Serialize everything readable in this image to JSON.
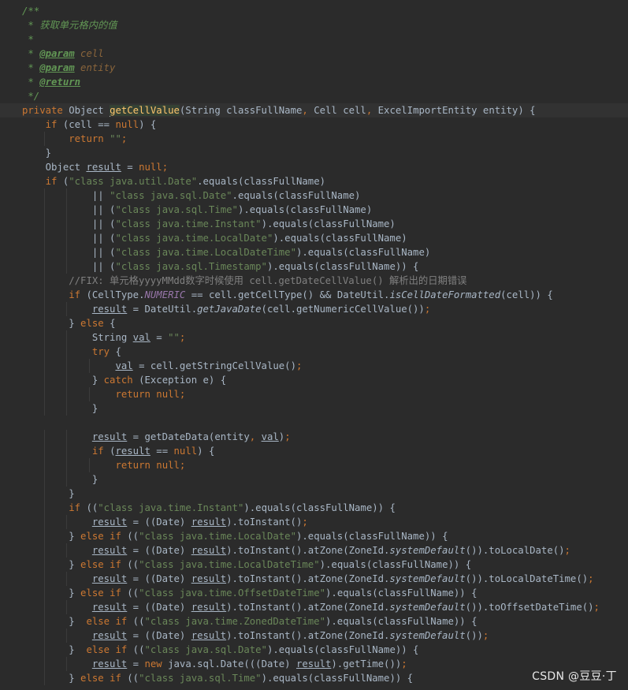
{
  "editor": {
    "theme_colors": {
      "background": "#2b2b2b",
      "default_text": "#a9b7c6",
      "keyword": "#cc7832",
      "string": "#6a8759",
      "doc_comment": "#629755",
      "line_comment": "#808080",
      "method_declaration": "#ffc66d",
      "static_field": "#9876aa"
    },
    "lines": [
      {
        "tokens": [
          {
            "t": "/**",
            "c": "cmt"
          }
        ]
      },
      {
        "tokens": [
          {
            "t": " * 获取单元格内的值",
            "c": "cmt"
          }
        ]
      },
      {
        "tokens": [
          {
            "t": " *",
            "c": "cmt"
          }
        ]
      },
      {
        "tokens": [
          {
            "t": " * ",
            "c": "cmt"
          },
          {
            "t": "@param",
            "c": "tag"
          },
          {
            "t": " cell",
            "c": "tagval"
          }
        ]
      },
      {
        "tokens": [
          {
            "t": " * ",
            "c": "cmt"
          },
          {
            "t": "@param",
            "c": "tag"
          },
          {
            "t": " entity",
            "c": "tagval"
          }
        ]
      },
      {
        "tokens": [
          {
            "t": " * ",
            "c": "cmt"
          },
          {
            "t": "@return",
            "c": "tag"
          }
        ]
      },
      {
        "tokens": [
          {
            "t": " */",
            "c": "cmt"
          }
        ]
      },
      {
        "caret": true,
        "tokens": [
          {
            "t": "private ",
            "c": "kw"
          },
          {
            "t": "Object "
          },
          {
            "caret": true
          },
          {
            "t": "getCellValue",
            "c": "fn-decl hl"
          },
          {
            "t": "(String classFullName"
          },
          {
            "t": ", ",
            "c": "kw"
          },
          {
            "t": "Cell cell"
          },
          {
            "t": ", ",
            "c": "kw"
          },
          {
            "t": "ExcelImportEntity entity) {"
          }
        ]
      },
      {
        "tokens": [
          {
            "t": "    "
          },
          {
            "t": "if ",
            "c": "kw"
          },
          {
            "t": "(cell == "
          },
          {
            "t": "null",
            "c": "kw"
          },
          {
            "t": ") {"
          }
        ]
      },
      {
        "tokens": [
          {
            "t": "        "
          },
          {
            "t": "return ",
            "c": "kw"
          },
          {
            "t": "\"\"",
            "c": "str"
          },
          {
            "t": ";",
            "c": "kw"
          }
        ]
      },
      {
        "tokens": [
          {
            "t": "    }"
          }
        ]
      },
      {
        "tokens": [
          {
            "t": "    Object "
          },
          {
            "t": "result",
            "c": "ul"
          },
          {
            "t": " = "
          },
          {
            "t": "null",
            "c": "kw"
          },
          {
            "t": ";",
            "c": "kw"
          }
        ]
      },
      {
        "tokens": [
          {
            "t": "    "
          },
          {
            "t": "if ",
            "c": "kw"
          },
          {
            "t": "("
          },
          {
            "t": "\"class java.util.Date\"",
            "c": "str"
          },
          {
            "t": ".equals(classFullName)"
          }
        ]
      },
      {
        "tokens": [
          {
            "t": "            || "
          },
          {
            "t": "\"class java.sql.Date\"",
            "c": "str"
          },
          {
            "t": ".equals(classFullName)"
          }
        ]
      },
      {
        "tokens": [
          {
            "t": "            || ("
          },
          {
            "t": "\"class java.sql.Time\"",
            "c": "str"
          },
          {
            "t": ").equals(classFullName)"
          }
        ]
      },
      {
        "tokens": [
          {
            "t": "            || ("
          },
          {
            "t": "\"class java.time.Instant\"",
            "c": "str"
          },
          {
            "t": ").equals(classFullName)"
          }
        ]
      },
      {
        "tokens": [
          {
            "t": "            || ("
          },
          {
            "t": "\"class java.time.LocalDate\"",
            "c": "str"
          },
          {
            "t": ").equals(classFullName)"
          }
        ]
      },
      {
        "tokens": [
          {
            "t": "            || ("
          },
          {
            "t": "\"class java.time.LocalDateTime\"",
            "c": "str"
          },
          {
            "t": ").equals(classFullName)"
          }
        ]
      },
      {
        "tokens": [
          {
            "t": "            || ("
          },
          {
            "t": "\"class java.sql.Timestamp\"",
            "c": "str"
          },
          {
            "t": ").equals(classFullName)) {"
          }
        ]
      },
      {
        "tokens": [
          {
            "t": "        "
          },
          {
            "t": "//FIX: 单元格yyyyMMdd数字时候使用 cell.getDateCellValue() 解析出的日期错误",
            "c": "line-cmt"
          }
        ]
      },
      {
        "tokens": [
          {
            "t": "        "
          },
          {
            "t": "if ",
            "c": "kw"
          },
          {
            "t": "(CellType."
          },
          {
            "t": "NUMERIC",
            "c": "static-field"
          },
          {
            "t": " == cell.getCellType() && DateUtil."
          },
          {
            "t": "isCellDateFormatted",
            "c": "static-call"
          },
          {
            "t": "(cell)) {"
          }
        ]
      },
      {
        "tokens": [
          {
            "t": "            "
          },
          {
            "t": "result",
            "c": "ul"
          },
          {
            "t": " = DateUtil."
          },
          {
            "t": "getJavaDate",
            "c": "static-call"
          },
          {
            "t": "(cell.getNumericCellValue())"
          },
          {
            "t": ";",
            "c": "kw"
          }
        ]
      },
      {
        "tokens": [
          {
            "t": "        } "
          },
          {
            "t": "else ",
            "c": "kw"
          },
          {
            "t": "{"
          }
        ]
      },
      {
        "tokens": [
          {
            "t": "            String "
          },
          {
            "t": "val",
            "c": "ul"
          },
          {
            "t": " = "
          },
          {
            "t": "\"\"",
            "c": "str"
          },
          {
            "t": ";",
            "c": "kw"
          }
        ]
      },
      {
        "tokens": [
          {
            "t": "            "
          },
          {
            "t": "try ",
            "c": "kw"
          },
          {
            "t": "{"
          }
        ]
      },
      {
        "tokens": [
          {
            "t": "                "
          },
          {
            "t": "val",
            "c": "ul"
          },
          {
            "t": " = cell.getStringCellValue()"
          },
          {
            "t": ";",
            "c": "kw"
          }
        ]
      },
      {
        "tokens": [
          {
            "t": "            } "
          },
          {
            "t": "catch ",
            "c": "kw"
          },
          {
            "t": "(Exception e) {"
          }
        ]
      },
      {
        "tokens": [
          {
            "t": "                "
          },
          {
            "t": "return null;",
            "c": "kw"
          }
        ]
      },
      {
        "tokens": [
          {
            "t": "            }"
          }
        ]
      },
      {
        "tokens": [
          {
            "t": ""
          }
        ]
      },
      {
        "tokens": [
          {
            "t": "            "
          },
          {
            "t": "result",
            "c": "ul"
          },
          {
            "t": " = getDateData(entity"
          },
          {
            "t": ", ",
            "c": "kw"
          },
          {
            "t": "val",
            "c": "ul"
          },
          {
            "t": ")"
          },
          {
            "t": ";",
            "c": "kw"
          }
        ]
      },
      {
        "tokens": [
          {
            "t": "            "
          },
          {
            "t": "if ",
            "c": "kw"
          },
          {
            "t": "("
          },
          {
            "t": "result",
            "c": "ul"
          },
          {
            "t": " == "
          },
          {
            "t": "null",
            "c": "kw"
          },
          {
            "t": ") {"
          }
        ]
      },
      {
        "tokens": [
          {
            "t": "                "
          },
          {
            "t": "return null;",
            "c": "kw"
          }
        ]
      },
      {
        "tokens": [
          {
            "t": "            }"
          }
        ]
      },
      {
        "tokens": [
          {
            "t": "        }"
          }
        ]
      },
      {
        "tokens": [
          {
            "t": "        "
          },
          {
            "t": "if ",
            "c": "kw"
          },
          {
            "t": "(("
          },
          {
            "t": "\"class java.time.Instant\"",
            "c": "str"
          },
          {
            "t": ").equals(classFullName)) {"
          }
        ]
      },
      {
        "tokens": [
          {
            "t": "            "
          },
          {
            "t": "result",
            "c": "ul"
          },
          {
            "t": " = ((Date) "
          },
          {
            "t": "result",
            "c": "ul"
          },
          {
            "t": ").toInstant()"
          },
          {
            "t": ";",
            "c": "kw"
          }
        ]
      },
      {
        "tokens": [
          {
            "t": "        } "
          },
          {
            "t": "else if ",
            "c": "kw"
          },
          {
            "t": "(("
          },
          {
            "t": "\"class java.time.LocalDate\"",
            "c": "str"
          },
          {
            "t": ").equals(classFullName)) {"
          }
        ]
      },
      {
        "tokens": [
          {
            "t": "            "
          },
          {
            "t": "result",
            "c": "ul"
          },
          {
            "t": " = ((Date) "
          },
          {
            "t": "result",
            "c": "ul"
          },
          {
            "t": ").toInstant().atZone(ZoneId."
          },
          {
            "t": "systemDefault",
            "c": "static-call"
          },
          {
            "t": "()).toLocalDate()"
          },
          {
            "t": ";",
            "c": "kw"
          }
        ]
      },
      {
        "tokens": [
          {
            "t": "        } "
          },
          {
            "t": "else if ",
            "c": "kw"
          },
          {
            "t": "(("
          },
          {
            "t": "\"class java.time.LocalDateTime\"",
            "c": "str"
          },
          {
            "t": ").equals(classFullName)) {"
          }
        ]
      },
      {
        "tokens": [
          {
            "t": "            "
          },
          {
            "t": "result",
            "c": "ul"
          },
          {
            "t": " = ((Date) "
          },
          {
            "t": "result",
            "c": "ul"
          },
          {
            "t": ").toInstant().atZone(ZoneId."
          },
          {
            "t": "systemDefault",
            "c": "static-call"
          },
          {
            "t": "()).toLocalDateTime()"
          },
          {
            "t": ";",
            "c": "kw"
          }
        ]
      },
      {
        "tokens": [
          {
            "t": "        } "
          },
          {
            "t": "else if ",
            "c": "kw"
          },
          {
            "t": "(("
          },
          {
            "t": "\"class java.time.OffsetDateTime\"",
            "c": "str"
          },
          {
            "t": ").equals(classFullName)) {"
          }
        ]
      },
      {
        "tokens": [
          {
            "t": "            "
          },
          {
            "t": "result",
            "c": "ul"
          },
          {
            "t": " = ((Date) "
          },
          {
            "t": "result",
            "c": "ul"
          },
          {
            "t": ").toInstant().atZone(ZoneId."
          },
          {
            "t": "systemDefault",
            "c": "static-call"
          },
          {
            "t": "()).toOffsetDateTime()"
          },
          {
            "t": ";",
            "c": "kw"
          }
        ]
      },
      {
        "tokens": [
          {
            "t": "        }  "
          },
          {
            "t": "else if ",
            "c": "kw"
          },
          {
            "t": "(("
          },
          {
            "t": "\"class java.time.ZonedDateTime\"",
            "c": "str"
          },
          {
            "t": ").equals(classFullName)) {"
          }
        ]
      },
      {
        "tokens": [
          {
            "t": "            "
          },
          {
            "t": "result",
            "c": "ul"
          },
          {
            "t": " = ((Date) "
          },
          {
            "t": "result",
            "c": "ul"
          },
          {
            "t": ").toInstant().atZone(ZoneId."
          },
          {
            "t": "systemDefault",
            "c": "static-call"
          },
          {
            "t": "())"
          },
          {
            "t": ";",
            "c": "kw"
          }
        ]
      },
      {
        "tokens": [
          {
            "t": "        }  "
          },
          {
            "t": "else if ",
            "c": "kw"
          },
          {
            "t": "(("
          },
          {
            "t": "\"class java.sql.Date\"",
            "c": "str"
          },
          {
            "t": ").equals(classFullName)) {"
          }
        ]
      },
      {
        "tokens": [
          {
            "t": "            "
          },
          {
            "t": "result",
            "c": "ul"
          },
          {
            "t": " = "
          },
          {
            "t": "new ",
            "c": "kw"
          },
          {
            "t": "java.sql.Date(((Date) "
          },
          {
            "t": "result",
            "c": "ul"
          },
          {
            "t": ").getTime())"
          },
          {
            "t": ";",
            "c": "kw"
          }
        ]
      },
      {
        "tokens": [
          {
            "t": "        } "
          },
          {
            "t": "else if ",
            "c": "kw"
          },
          {
            "t": "(("
          },
          {
            "t": "\"class java.sql.Time\"",
            "c": "str"
          },
          {
            "t": ").equals(classFullName)) {"
          }
        ]
      }
    ]
  },
  "watermark": {
    "text": "CSDN @豆豆·丁"
  }
}
